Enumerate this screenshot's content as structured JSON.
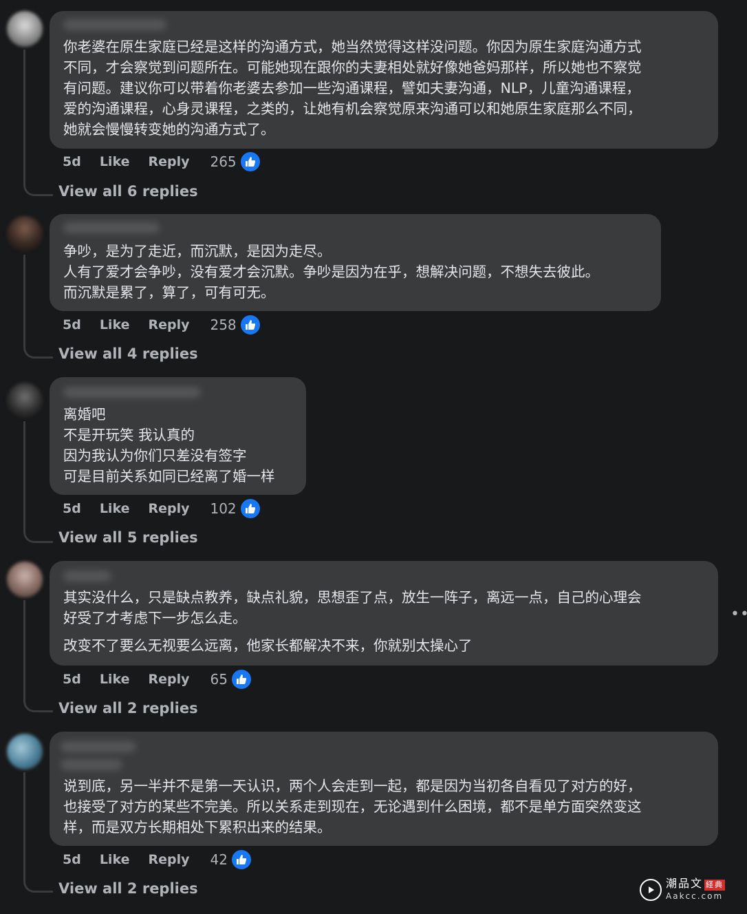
{
  "comments": [
    {
      "lines": [
        "你老婆在原生家庭已经是这样的沟通方式，她当然觉得这样没问题。你因为原生家庭沟通方式",
        "不同，才会察觉到问题所在。可能她现在跟你的夫妻相处就好像她爸妈那样，所以她也不察觉",
        "有问题。建议你可以带着你老婆去参加一些沟通课程，譬如夫妻沟通，NLP，儿童沟通课程，",
        "爱的沟通课程，心身灵课程，之类的，让她有机会察觉原来沟通可以和她原生家庭那么不同，",
        "她就会慢慢转变她的沟通方式了。"
      ],
      "time": "5d",
      "like": "Like",
      "reply": "Reply",
      "count": "265",
      "view_replies": "View all 6 replies"
    },
    {
      "lines": [
        "争吵，是为了走近，而沉默，是因为走尽。",
        "人有了爱才会争吵，没有爱才会沉默。争吵是因为在乎，想解决问题，不想失去彼此。",
        "而沉默是累了，算了，可有可无。"
      ],
      "time": "5d",
      "like": "Like",
      "reply": "Reply",
      "count": "258",
      "view_replies": "View all 4 replies"
    },
    {
      "lines": [
        "离婚吧",
        "不是开玩笑 我认真的",
        "因为我认为你们只差没有签字",
        "可是目前关系如同已经离了婚一样"
      ],
      "time": "5d",
      "like": "Like",
      "reply": "Reply",
      "count": "102",
      "view_replies": "View all 5 replies"
    },
    {
      "lines": [
        "其实没什么，只是缺点教养，缺点礼貌，思想歪了点，放生一阵子，离远一点，自己的心理会",
        "好受了才考虑下一步怎么走。",
        "改变不了要么无视要么远离，他家长都解决不来，你就别太操心了"
      ],
      "time": "5d",
      "like": "Like",
      "reply": "Reply",
      "count": "65",
      "view_replies": "View all 2 replies"
    },
    {
      "lines": [
        "说到底，另一半并不是第一天认识，两个人会走到一起，都是因为当初各自看见了对方的好，",
        "也接受了对方的某些不完美。所以关系走到现在，无论遇到什么困境，都不是单方面突然变这",
        "样，而是双方长期相处下累积出来的结果。"
      ],
      "time": "5d",
      "like": "Like",
      "reply": "Reply",
      "count": "42",
      "view_replies": "View all 2 replies"
    }
  ],
  "more_icon": "more-horizontal-icon",
  "like_icon": "thumbs-up-icon",
  "watermark": {
    "top": "潮品文",
    "bottom": "Aakcc.com",
    "badge": "経典"
  },
  "colors": {
    "background": "#18191a",
    "bubble": "#3a3b3c",
    "like_blue": "#1877f2",
    "muted_text": "#b0b3b8"
  }
}
